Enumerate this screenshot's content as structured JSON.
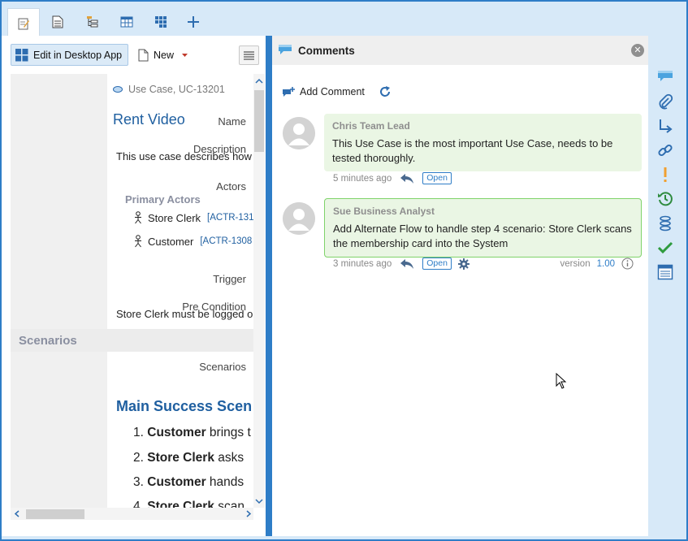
{
  "tabs": [
    {
      "name": "edit-tab-icon"
    },
    {
      "name": "document-tab-icon"
    },
    {
      "name": "hierarchy-tab-icon"
    },
    {
      "name": "table-tab-icon"
    },
    {
      "name": "grid-tab-icon"
    },
    {
      "name": "add-tab-icon"
    }
  ],
  "toolbar": {
    "edit_desktop_label": "Edit in Desktop App",
    "new_label": "New"
  },
  "item": {
    "type_id": "Use Case, UC-13201",
    "name_label": "Name",
    "name_value": "Rent Video",
    "description_label": "Description",
    "description_value": "This use case describes how",
    "actors_label": "Actors",
    "primary_actors_label": "Primary Actors",
    "actors": [
      {
        "name": "Store Clerk",
        "id": "[ACTR-131"
      },
      {
        "name": "Customer",
        "id": "[ACTR-1308"
      }
    ],
    "trigger_label": "Trigger",
    "precondition_label": "Pre Condition",
    "precondition_value": "Store Clerk must be logged o",
    "scenarios_section": "Scenarios",
    "scenarios_label": "Scenarios",
    "main_scenario_title": "Main Success Scen",
    "steps": [
      {
        "num": "1.",
        "actor": "Customer",
        "text": "brings t"
      },
      {
        "num": "2.",
        "actor": "Store Clerk",
        "text": "asks"
      },
      {
        "num": "3.",
        "actor": "Customer",
        "text": "hands"
      },
      {
        "num": "4.",
        "actor": "Store Clerk",
        "text": "scan"
      }
    ]
  },
  "comments_panel": {
    "title": "Comments",
    "add_label": "Add Comment",
    "comments": [
      {
        "author": "Chris Team Lead",
        "text": "This Use Case is the most important Use Case, needs to be tested thoroughly.",
        "time": "5 minutes ago",
        "status": "Open"
      },
      {
        "author": "Sue Business Analyst",
        "text": "Add Alternate Flow to handle step 4 scenario: Store Clerk scans the membership card into the System",
        "time": "3 minutes ago",
        "status": "Open",
        "version_label": "version",
        "version_value": "1.00"
      }
    ]
  },
  "rail_icons": [
    "comments-icon",
    "attachment-icon",
    "trace-arrow-icon",
    "link-icon",
    "alert-icon",
    "history-icon",
    "layers-icon",
    "review-check-icon",
    "table-view-icon"
  ],
  "colors": {
    "accent": "#2e7dc7",
    "link": "#1f5fa0",
    "comment_bg": "#eaf6e4",
    "selected_border": "#7fd36a",
    "rail_bg": "#d7e9f8"
  }
}
